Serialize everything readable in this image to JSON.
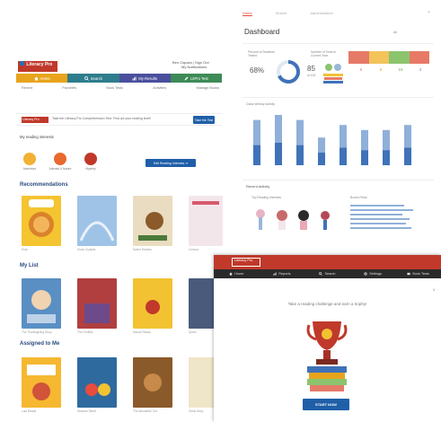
{
  "left": {
    "logo_text": "Literacy Pro",
    "account_line1": "Ben Ciquian | Sign Out",
    "account_line2": "My Notifications",
    "nav": [
      {
        "label": "Home",
        "icon": "home-icon",
        "color": "#e8a41c"
      },
      {
        "label": "Search",
        "icon": "search-icon",
        "color": "#2e7d8c"
      },
      {
        "label": "My Results",
        "icon": "chart-icon",
        "color": "#4a4f9c"
      },
      {
        "label": "LitPro Test",
        "icon": "pencil-icon",
        "color": "#3d8b57"
      }
    ],
    "subnav": [
      "Recent",
      "Favorites",
      "Book Tests",
      "Activities",
      "Manage Books"
    ],
    "banner": {
      "logo_text": "Literacy Pro",
      "text": "Take the Literacy Pro Comprehension Test. Find out your reading level!",
      "button": "Take the Test"
    },
    "interests_title": "My reading interests",
    "interests": [
      {
        "label": "Adventure",
        "color": "#f2b134"
      },
      {
        "label": "Animals & Nature",
        "color": "#e8692e"
      },
      {
        "label": "Mystery",
        "color": "#c0392b"
      }
    ],
    "interests_button": "Edit Reading Interests",
    "sections": {
      "recommendations": "Recommendations",
      "my_list": "My List",
      "assigned": "Assigned to Me"
    },
    "rec_books": [
      {
        "title": "Hola",
        "color": "#f4c431"
      },
      {
        "title": "Snow Crystals",
        "color": "#9fc3e6"
      },
      {
        "title": "Sweet Dreams",
        "color": "#e9dcc0"
      },
      {
        "title": "Curious",
        "color": "#f3e6ea"
      }
    ],
    "list_books": [
      {
        "title": "The Thanksgiving Story",
        "color": "#5a8fc4"
      },
      {
        "title": "The Gruffalo",
        "color": "#b13f3f"
      },
      {
        "title": "Mouse Ready",
        "color": "#f2c233"
      },
      {
        "title": "Quest",
        "color": "#4a5a7a"
      }
    ],
    "assigned_books": [
      {
        "title": "Lola Reads",
        "color": "#f5b830"
      },
      {
        "title": "Sesame Street",
        "color": "#2f6a9e"
      },
      {
        "title": "The Wonderful Cat",
        "color": "#8b5a2b"
      },
      {
        "title": "Great Story",
        "color": "#efe6c9"
      }
    ]
  },
  "dashboard": {
    "tabs": [
      "Home",
      "Search",
      "Administration"
    ],
    "title": "Dashboard",
    "filter": "All",
    "metric1": {
      "label": "Percent of Students Tested",
      "value": "68%",
      "progress": 0.68
    },
    "metric2": {
      "label": "Number of Tests in Current Year",
      "value": "85",
      "sub": "of 130"
    },
    "levels": [
      {
        "label": "Below",
        "color": "#e57a67",
        "value": "5"
      },
      {
        "label": "Approaching",
        "color": "#f2c45a",
        "value": "8"
      },
      {
        "label": "On Level",
        "color": "#8cc46e",
        "value": "15"
      },
      {
        "label": "Above",
        "color": "#9ab7d9",
        "value": "3"
      }
    ],
    "weekly_title": "Class Weekly Activity",
    "weekly": [
      {
        "day": "Mon",
        "light": 10,
        "dark": 8
      },
      {
        "day": "Tue",
        "light": 11,
        "dark": 9
      },
      {
        "day": "Wed",
        "light": 10,
        "dark": 8
      },
      {
        "day": "Thu",
        "light": 6,
        "dark": 5
      },
      {
        "day": "Fri",
        "light": 9,
        "dark": 7
      },
      {
        "day": "Sat",
        "light": 8,
        "dark": 6
      },
      {
        "day": "Sun",
        "light": 8,
        "dark": 6
      },
      {
        "day": "Mon2",
        "light": 9,
        "dark": 7
      }
    ],
    "recent_title": "Recent Activity",
    "recent_sub1": "Top Reading Interests",
    "recent_sub2": "Books Read"
  },
  "reports": {
    "logo_text": "Literacy Pro",
    "nav": [
      {
        "label": "Home",
        "icon": "home-icon"
      },
      {
        "label": "Reports",
        "icon": "chart-icon"
      },
      {
        "label": "Search",
        "icon": "search-icon"
      },
      {
        "label": "Settings",
        "icon": "gear-icon"
      },
      {
        "label": "Book Tests",
        "icon": "book-icon"
      }
    ],
    "message": "Take a reading challenge and earn a trophy!",
    "start_button": "START NOW"
  },
  "colors": {
    "accent_red": "#c0392b",
    "accent_blue": "#1f5fa8",
    "dash_blue": "#3f72b8",
    "dash_light": "#8fb0d9"
  }
}
